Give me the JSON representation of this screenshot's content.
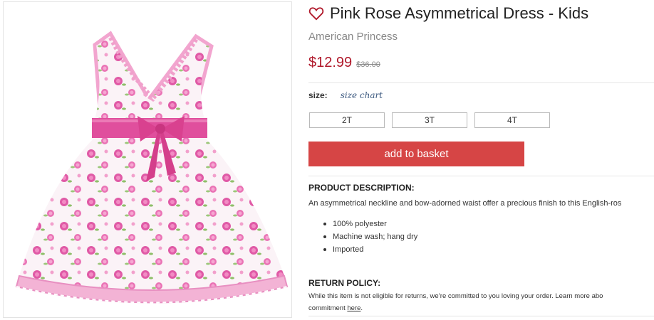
{
  "product": {
    "title": "Pink Rose Asymmetrical Dress - Kids",
    "brand": "American Princess",
    "price": "$12.99",
    "original_price": "$36.00"
  },
  "size": {
    "label": "size:",
    "chart_link": "size chart",
    "options": [
      "2T",
      "3T",
      "4T"
    ]
  },
  "cart": {
    "add_label": "add to basket"
  },
  "description": {
    "heading": "PRODUCT DESCRIPTION:",
    "text": "An asymmetrical neckline and bow-adorned waist offer a precious finish to this English-ros",
    "bullets": [
      "100% polyester",
      "Machine wash; hang dry",
      "Imported"
    ]
  },
  "return_policy": {
    "heading": "RETURN POLICY:",
    "line1": "While this item is not eligible for returns, we’re committed to you loving your order. Learn more abo",
    "line2_prefix": "commitment ",
    "link": "here",
    "line2_suffix": "."
  },
  "colors": {
    "price": "#b0192b",
    "button": "#d64545",
    "dress_pink": "#e76bb0",
    "link": "#3d5a80"
  },
  "icons": {
    "favorite": "heart-outline-icon"
  }
}
